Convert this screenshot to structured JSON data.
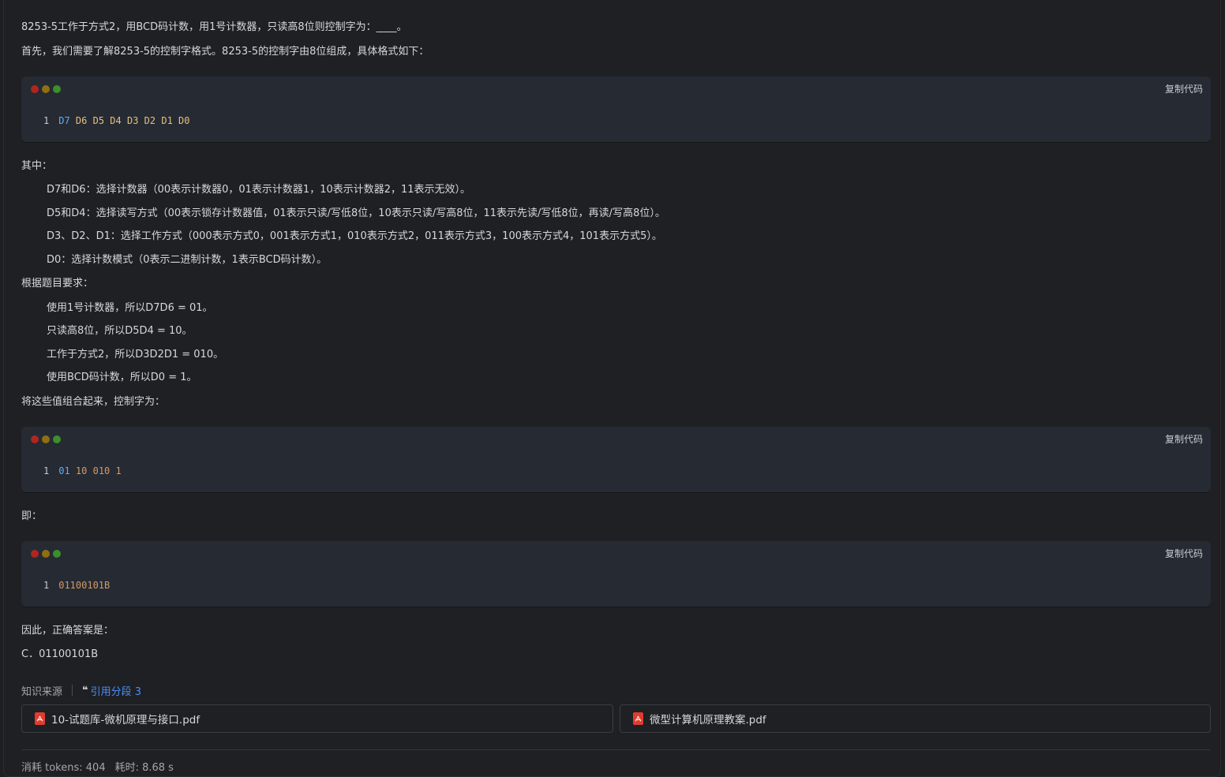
{
  "answer": {
    "question": "8253-5工作于方式2，用BCD码计数，用1号计数器，只读高8位则控制字为：____。",
    "intro": "首先，我们需要了解8253-5的控制字格式。8253-5的控制字由8位组成，具体格式如下：",
    "where_label": "其中：",
    "where_items": [
      "D7和D6：选择计数器（00表示计数器0，01表示计数器1，10表示计数器2，11表示无效）。",
      "D5和D4：选择读写方式（00表示锁存计数器值，01表示只读/写低8位，10表示只读/写高8位，11表示先读/写低8位，再读/写高8位）。",
      "D3、D2、D1：选择工作方式（000表示方式0，001表示方式1，010表示方式2，011表示方式3，100表示方式4，101表示方式5）。",
      "D0：选择计数模式（0表示二进制计数，1表示BCD码计数）。"
    ],
    "req_label": "根据题目要求：",
    "req_items": [
      "使用1号计数器，所以D7D6 = 01。",
      "只读高8位，所以D5D4 = 10。",
      "工作于方式2，所以D3D2D1 = 010。",
      "使用BCD码计数，所以D0 = 1。"
    ],
    "combine_label": "将这些值组合起来，控制字为：",
    "ie_label": "即：",
    "conclusion_label": "因此，正确答案是：",
    "final_answer": "C．01100101B"
  },
  "code_blocks": [
    {
      "copy_label": "复制代码",
      "line_no": "1",
      "tokens": [
        {
          "text": "D7",
          "color": "blue"
        },
        {
          "text": "D6",
          "color": "yellow"
        },
        {
          "text": "D5",
          "color": "yellow"
        },
        {
          "text": "D4",
          "color": "yellow"
        },
        {
          "text": "D3",
          "color": "yellow"
        },
        {
          "text": "D2",
          "color": "yellow"
        },
        {
          "text": "D1",
          "color": "yellow"
        },
        {
          "text": "D0",
          "color": "yellow"
        }
      ]
    },
    {
      "copy_label": "复制代码",
      "line_no": "1",
      "tokens": [
        {
          "text": "01",
          "color": "blue"
        },
        {
          "text": "10",
          "color": "orange"
        },
        {
          "text": "010",
          "color": "orange"
        },
        {
          "text": "1",
          "color": "orange"
        }
      ]
    },
    {
      "copy_label": "复制代码",
      "line_no": "1",
      "tokens": [
        {
          "text": "01100101B",
          "color": "orange"
        }
      ]
    }
  ],
  "sources": {
    "label": "知识来源",
    "cite_label": "引用分段 3",
    "files": [
      {
        "name": "10-试题库-微机原理与接口.pdf",
        "icon": "pdf-icon"
      },
      {
        "name": "微型计算机原理教案.pdf",
        "icon": "pdf-icon"
      }
    ]
  },
  "stats": {
    "tokens": "消耗 tokens: 404",
    "time": "耗时: 8.68 s"
  },
  "colors": {
    "background": "#1f2023",
    "code_background": "#262a33",
    "link": "#4c8df6",
    "token_blue": "#61aeee",
    "token_yellow": "#e5c07b",
    "token_orange": "#d19a66",
    "pdf_red": "#e03c31"
  }
}
